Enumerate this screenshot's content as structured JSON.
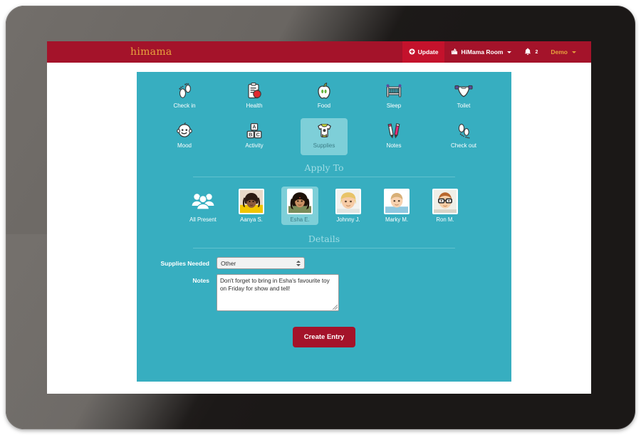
{
  "app": {
    "brand": "himama",
    "accent_red": "#a4132a",
    "accent_teal": "#37aec0",
    "accent_gold": "#e8a33d",
    "selected_teal": "#7ecfd8"
  },
  "topnav": {
    "update_label": "Update",
    "update_icon": "plus-circle-icon",
    "room_label": "HiMama Room",
    "room_icon": "building-icon",
    "bell_icon": "bell-icon",
    "bell_count": "2",
    "account_label": "Demo"
  },
  "tiles": {
    "row1": [
      {
        "label": "Check in",
        "icon": "footprints-icon",
        "selected": false
      },
      {
        "label": "Health",
        "icon": "clipboard-apple-icon",
        "selected": false
      },
      {
        "label": "Food",
        "icon": "apple-icon",
        "selected": false
      },
      {
        "label": "Sleep",
        "icon": "crib-icon",
        "selected": false
      },
      {
        "label": "Toilet",
        "icon": "diaper-icon",
        "selected": false
      }
    ],
    "row2": [
      {
        "label": "Mood",
        "icon": "smiley-baby-icon",
        "selected": false
      },
      {
        "label": "Activity",
        "icon": "abc-blocks-icon",
        "selected": false
      },
      {
        "label": "Supplies",
        "icon": "onesie-icon",
        "selected": true
      },
      {
        "label": "Notes",
        "icon": "pencils-icon",
        "selected": false
      },
      {
        "label": "Check out",
        "icon": "footprints-icon",
        "selected": false
      }
    ]
  },
  "apply_to": {
    "title": "Apply To",
    "children": [
      {
        "name": "All Present",
        "icon": "group-people-icon",
        "selected": false
      },
      {
        "name": "Aanya S.",
        "icon": "child-photo",
        "selected": false
      },
      {
        "name": "Esha E.",
        "icon": "child-photo",
        "selected": true
      },
      {
        "name": "Johnny J.",
        "icon": "child-photo",
        "selected": false
      },
      {
        "name": "Marky M.",
        "icon": "child-photo",
        "selected": false
      },
      {
        "name": "Ron M.",
        "icon": "child-photo",
        "selected": false
      }
    ]
  },
  "details": {
    "title": "Details",
    "supplies_label": "Supplies Needed",
    "supplies_value": "Other",
    "notes_label": "Notes",
    "notes_value": "Don't forget to bring in Esha's favourite toy on Friday for show and tell!",
    "notes_placeholder": ""
  },
  "submit": {
    "label": "Create Entry"
  }
}
